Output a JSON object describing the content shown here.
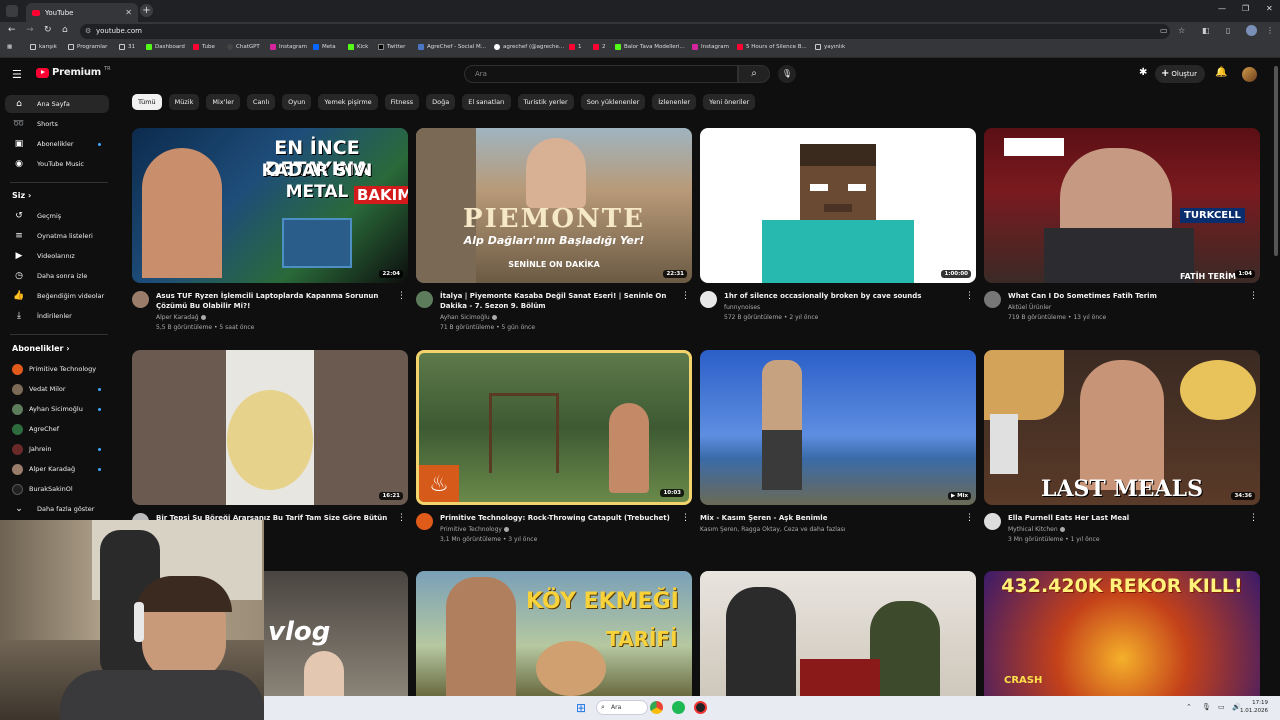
{
  "browser": {
    "tab_title": "YouTube",
    "url": "youtube.com",
    "bookmarks": [
      "karışık",
      "Programlar",
      "31",
      "Dashboard",
      "Tube",
      "ChatGPT",
      "Instagram",
      "Meta",
      "Kick",
      "Twitter",
      "AgreChef - Social M...",
      "agrechef (@agreche...",
      "1",
      "2",
      "Balor Tava Modelleri...",
      "Instagram",
      "5 Hours of Silence B...",
      "yayınlık"
    ]
  },
  "header": {
    "logo": "Premium",
    "logo_sup": "TR",
    "search_placeholder": "Ara",
    "create_label": "Oluştur"
  },
  "sidebar": {
    "main_items": [
      {
        "label": "Ana Sayfa",
        "icon": "home-icon"
      },
      {
        "label": "Shorts",
        "icon": "shorts-icon"
      },
      {
        "label": "Abonelikler",
        "icon": "subscriptions-icon"
      },
      {
        "label": "YouTube Music",
        "icon": "music-icon"
      }
    ],
    "you_heading": "Siz",
    "you_items": [
      {
        "label": "Geçmiş",
        "icon": "history-icon"
      },
      {
        "label": "Oynatma listeleri",
        "icon": "playlists-icon"
      },
      {
        "label": "Videolarınız",
        "icon": "your-videos-icon"
      },
      {
        "label": "Daha sonra izle",
        "icon": "watch-later-icon"
      },
      {
        "label": "Beğendiğim videolar",
        "icon": "liked-icon"
      },
      {
        "label": "İndirilenler",
        "icon": "download-icon"
      }
    ],
    "subs_heading": "Abonelikler",
    "subscriptions": [
      {
        "label": "Primitive Technology",
        "color": "#e05a1a"
      },
      {
        "label": "Vedat Milor",
        "color": "#7b6a55"
      },
      {
        "label": "Ayhan Sicimoğlu",
        "color": "#5d7c5b"
      },
      {
        "label": "AgreChef",
        "color": "#2e6b3d"
      },
      {
        "label": "Jahrein",
        "color": "#6a2a2a"
      },
      {
        "label": "Alper Karadağ",
        "color": "#9a7c6b"
      },
      {
        "label": "BurakSakinOl",
        "color": "#222222"
      }
    ],
    "show_more": "Daha fazla göster"
  },
  "chips": [
    "Tümü",
    "Müzik",
    "Mix'ler",
    "Canlı",
    "Oyun",
    "Yemek pişirme",
    "Fitness",
    "Doğa",
    "El sanatları",
    "Turistik yerler",
    "Son yüklenenler",
    "İzlenenler",
    "Yeni öneriler"
  ],
  "videos": [
    {
      "title": "Asus TUF Ryzen İşlemcili Laptoplarda Kapanma Sorunun Çözümü Bu Olabilir Mi?!",
      "channel": "Alper Karadağ",
      "stats": "5,5 B görüntüleme • 5 saat önce",
      "duration": "22:04",
      "overlay": [
        "EN İNCE DETAYINA",
        "KADAR SIVI METAL",
        "BAKIMI"
      ]
    },
    {
      "title": "İtalya | Piyemonte Kasaba Değil Sanat Eseri! | Seninle On Dakika - 7. Sezon 9. Bölüm",
      "channel": "Ayhan Sicimoğlu",
      "stats": "71 B görüntüleme • 5 gün önce",
      "duration": "22:31",
      "overlay": [
        "PIEMONTE",
        "Alp Dağları'nın Başladığı Yer!",
        "SENİNLE ON DAKİKA"
      ]
    },
    {
      "title": "1hr of silence occasionally broken by cave sounds",
      "channel": "funnynoises",
      "stats": "572 B görüntüleme • 2 yıl önce",
      "duration": "1:00:00"
    },
    {
      "title": "What Can I Do Sometimes Fatih Terim",
      "channel": "Aktüel Ürünler",
      "stats": "719 B görüntüleme • 13 yıl önce",
      "duration": "1:04",
      "overlay": [
        "FATİH TERİM",
        "TURKCELL"
      ]
    },
    {
      "title": "Bir Tepsi Su Böreği Ararsanız Bu Tarif Tam Size Göre Bütün",
      "channel": "",
      "stats": "",
      "duration": "16:21"
    },
    {
      "title": "Primitive Technology: Rock-Throwing Catapult (Trebuchet)",
      "channel": "Primitive Technology",
      "stats": "3,1 Mn görüntüleme • 3 yıl önce",
      "duration": "10:03"
    },
    {
      "title": "Mix - Kasım Şeren - Aşk Benimle",
      "channel": "Kasım Şeren, Ragga Oktay, Ceza ve daha fazlası",
      "stats": "",
      "duration": "Mix"
    },
    {
      "title": "Ella Purnell Eats Her Last Meal",
      "channel": "Mythical Kitchen",
      "stats": "3 Mn görüntüleme • 1 yıl önce",
      "duration": "34:36",
      "overlay": [
        "LAST MEALS"
      ]
    },
    {
      "overlay": [
        "vlog"
      ]
    },
    {
      "overlay": [
        "KÖY EKMEĞİ",
        "TARİFİ"
      ]
    },
    {},
    {
      "overlay": [
        "432.420K REKOR KILL!",
        "CRASH"
      ]
    }
  ],
  "taskbar": {
    "search": "Ara",
    "time": "17:19",
    "date": "1.01.2026"
  }
}
